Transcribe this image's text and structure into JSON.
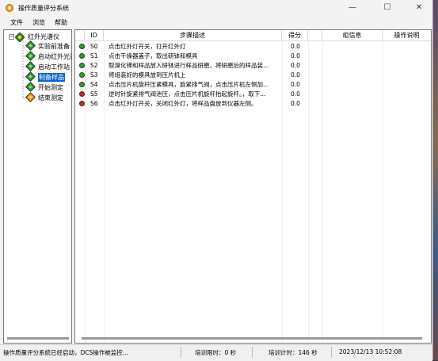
{
  "window": {
    "title": "操作质量评分系统",
    "controls": {
      "minimize": "—",
      "maximize": "☐",
      "close": "✕"
    }
  },
  "menu": [
    "文件",
    "浏览",
    "帮助"
  ],
  "tree": {
    "root": "红外光谱仪",
    "nodes": [
      {
        "label": "实验前准备",
        "status": "green"
      },
      {
        "label": "启动红外光谱",
        "status": "green"
      },
      {
        "label": "启动工作站",
        "status": "green"
      },
      {
        "label": "制备样品",
        "status": "green",
        "selected": true
      },
      {
        "label": "开始测定",
        "status": "green"
      },
      {
        "label": "结束测定",
        "status": "orange"
      }
    ]
  },
  "table": {
    "headers": {
      "id": "ID",
      "step": "步骤描述",
      "score": "得分",
      "group": "组信息",
      "note": "操作说明"
    },
    "rows": [
      {
        "status": "green",
        "id": "S0",
        "step": "点击红外灯开关，打开红外灯",
        "score": "0.0"
      },
      {
        "status": "green",
        "id": "S1",
        "step": "点击干燥器盖子，取出研钵和模具",
        "score": "0.0"
      },
      {
        "status": "green",
        "id": "S2",
        "step": "取溴化钾和样品放入研钵进行样品研磨，将研磨后的样品装...",
        "score": "0.0"
      },
      {
        "status": "green",
        "id": "S3",
        "step": "将组装好的模具放到压片机上",
        "score": "0.0"
      },
      {
        "status": "green",
        "id": "S4",
        "step": "点击压片机旋杆压紧模具，旋紧排气阀，点击压片机左侧加...",
        "score": "0.0"
      },
      {
        "status": "red",
        "id": "S5",
        "step": "逆时针旋紧排气阀泄压，点击压片机旋杆抬起旋杆。，取下...",
        "score": "0.0"
      },
      {
        "status": "red",
        "id": "S6",
        "step": "点击红外灯开关，关闭红外灯，将样品盘放到仪器左侧。",
        "score": "0.0"
      }
    ]
  },
  "status_bar": {
    "message": "操作质量评分系统已经启动，DCS操作被监控...",
    "limit": "培训限时：0 秒",
    "elapsed": "培训计时：146 秒",
    "datetime": "2023/12/13 10:52:08"
  },
  "colors": {
    "green": "#2aa22a",
    "orange": "#f0a000",
    "red": "#d42020",
    "selection": "#0a64d2"
  }
}
